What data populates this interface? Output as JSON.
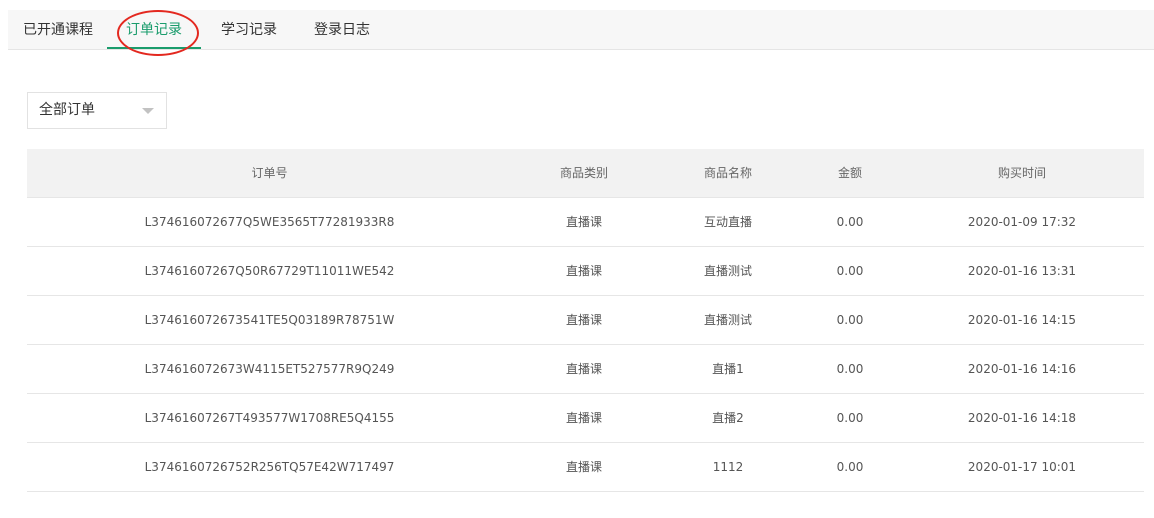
{
  "tabs": [
    {
      "label": "已开通课程"
    },
    {
      "label": "订单记录"
    },
    {
      "label": "学习记录"
    },
    {
      "label": "登录日志"
    }
  ],
  "filter": {
    "selected": "全部订单"
  },
  "table": {
    "headers": [
      "订单号",
      "商品类别",
      "商品名称",
      "金额",
      "购买时间"
    ],
    "rows": [
      [
        "L374616072677Q5WE3565T77281933R8",
        "直播课",
        "互动直播",
        "0.00",
        "2020-01-09 17:32"
      ],
      [
        "L37461607267Q50R67729T11011WE542",
        "直播课",
        "直播测试",
        "0.00",
        "2020-01-16 13:31"
      ],
      [
        "L374616072673541TE5Q03189R78751W",
        "直播课",
        "直播测试",
        "0.00",
        "2020-01-16 14:15"
      ],
      [
        "L374616072673W4115ET527577R9Q249",
        "直播课",
        "直播1",
        "0.00",
        "2020-01-16 14:16"
      ],
      [
        "L37461607267T493577W1708RE5Q4155",
        "直播课",
        "直播2",
        "0.00",
        "2020-01-16 14:18"
      ],
      [
        "L3746160726752R256TQ57E42W717497",
        "直播课",
        "1112",
        "0.00",
        "2020-01-17 10:01"
      ]
    ]
  },
  "colors": {
    "accent": "#1a9c6c",
    "highlight_circle": "#e3281f"
  }
}
